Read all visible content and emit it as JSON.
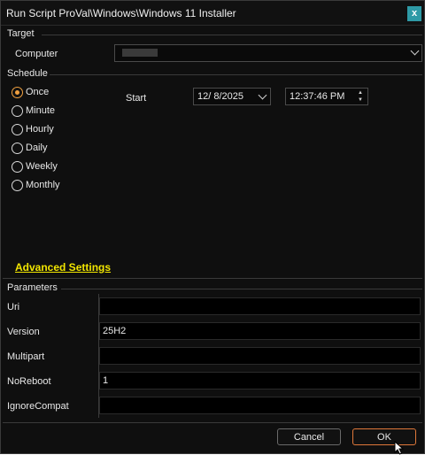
{
  "window": {
    "title": "Run Script ProVal\\Windows\\Windows 11 Installer",
    "close_label": "x"
  },
  "target": {
    "group_label": "Target",
    "computer_label": "Computer",
    "computer_value": ""
  },
  "schedule": {
    "group_label": "Schedule",
    "options": [
      {
        "label": "Once",
        "checked": true
      },
      {
        "label": "Minute",
        "checked": false
      },
      {
        "label": "Hourly",
        "checked": false
      },
      {
        "label": "Daily",
        "checked": false
      },
      {
        "label": "Weekly",
        "checked": false
      },
      {
        "label": "Monthly",
        "checked": false
      }
    ],
    "start_label": "Start",
    "start_date": "12/  8/2025",
    "start_time": "12:37:46 PM"
  },
  "advanced_settings_label": "Advanced Settings",
  "parameters": {
    "group_label": "Parameters",
    "items": [
      {
        "label": "Uri",
        "value": ""
      },
      {
        "label": "Version",
        "value": "25H2"
      },
      {
        "label": "Multipart",
        "value": ""
      },
      {
        "label": "NoReboot",
        "value": "1"
      },
      {
        "label": "IgnoreCompat",
        "value": ""
      }
    ]
  },
  "buttons": {
    "cancel": "Cancel",
    "ok": "OK"
  },
  "colors": {
    "accent": "#f0a040",
    "link": "#f2e600",
    "close_bg": "#2e9aa6",
    "ok_border": "#e0783a",
    "background": "#0f0f0f"
  },
  "icons": {
    "close": "close-icon",
    "dropdown": "chevron-down-icon",
    "spin_up": "caret-up-icon",
    "spin_down": "caret-down-icon",
    "cursor": "mouse-pointer-icon"
  }
}
